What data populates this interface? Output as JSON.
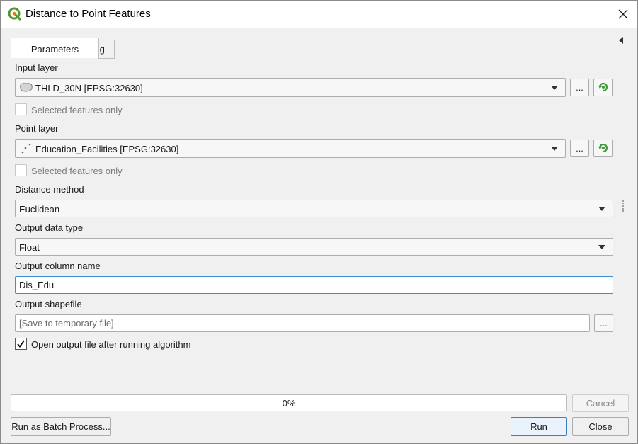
{
  "window": {
    "title": "Distance to Point Features"
  },
  "tabs": {
    "parameters": "Parameters",
    "log": "Log"
  },
  "params": {
    "input_layer_label": "Input layer",
    "input_layer_value": "THLD_30N [EPSG:32630]",
    "input_selected_label": "Selected features only",
    "point_layer_label": "Point layer",
    "point_layer_value": "Education_Facilities [EPSG:32630]",
    "point_selected_label": "Selected features only",
    "distance_method_label": "Distance method",
    "distance_method_value": "Euclidean",
    "output_type_label": "Output data type",
    "output_type_value": "Float",
    "output_column_label": "Output column name",
    "output_column_value": "Dis_Edu",
    "output_shapefile_label": "Output shapefile",
    "output_shapefile_placeholder": "[Save to temporary file]",
    "open_output_label": "Open output file after running algorithm",
    "open_output_checked": true,
    "browse_label": "..."
  },
  "footer": {
    "progress_text": "0%",
    "progress_value": 0,
    "cancel_label": "Cancel",
    "batch_label": "Run as Batch Process...",
    "run_label": "Run",
    "close_label": "Close"
  },
  "icons": {
    "app": "qgis-logo-icon",
    "polygon_layer": "polygon-layer-icon",
    "point_layer": "point-layer-icon",
    "iterate": "iterate-green-icon"
  },
  "colors": {
    "accent_focus": "#3f8fd2",
    "qgis_green": "#589632",
    "qgis_yellow": "#ee7913"
  }
}
